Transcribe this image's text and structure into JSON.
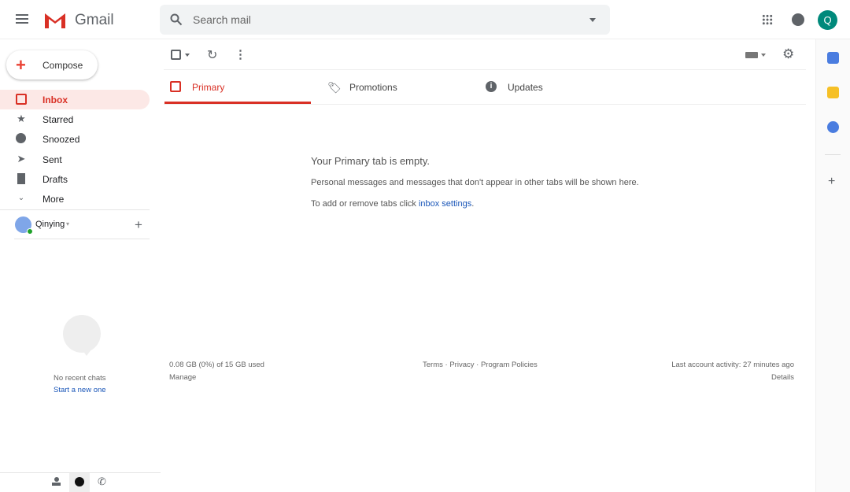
{
  "header": {
    "app_name": "Gmail",
    "search_placeholder": "Search mail",
    "avatar_letter": "Q"
  },
  "sidebar": {
    "compose": "Compose",
    "items": [
      {
        "label": "Inbox"
      },
      {
        "label": "Starred"
      },
      {
        "label": "Snoozed"
      },
      {
        "label": "Sent"
      },
      {
        "label": "Drafts"
      },
      {
        "label": "More"
      }
    ],
    "user": "Qinying",
    "no_chats": "No recent chats",
    "start_new": "Start a new one"
  },
  "tabs": [
    {
      "label": "Primary"
    },
    {
      "label": "Promotions"
    },
    {
      "label": "Updates"
    }
  ],
  "empty": {
    "title": "Your Primary tab is empty.",
    "desc": "Personal messages and messages that don't appear in other tabs will be shown here.",
    "settings_prefix": "To add or remove tabs click ",
    "settings_link": "inbox settings",
    "settings_suffix": "."
  },
  "footer": {
    "storage": "0.08 GB (0%) of 15 GB used",
    "manage": "Manage",
    "terms": "Terms",
    "privacy": "Privacy",
    "policies": "Program Policies",
    "sep": " · ",
    "activity": "Last account activity: 27 minutes ago",
    "details": "Details"
  },
  "colors": {
    "accent": "#d93025",
    "inbox_bg": "#fce8e6",
    "avatar": "#00897b",
    "link": "#1a56b8"
  }
}
